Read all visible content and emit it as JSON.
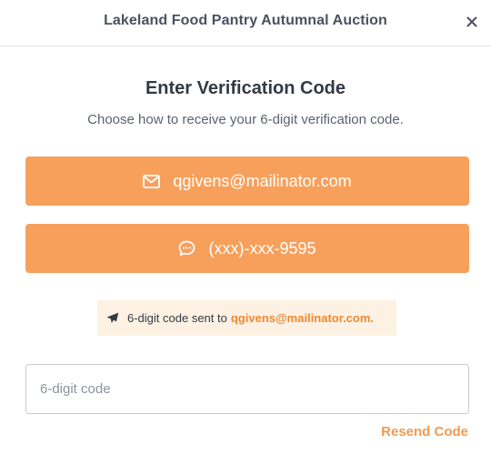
{
  "header": {
    "title": "Lakeland Food Pantry Autumnal Auction",
    "close_icon": "close-icon"
  },
  "main": {
    "heading": "Enter Verification Code",
    "subheading": "Choose how to receive your 6-digit verification code.",
    "options": [
      {
        "icon": "envelope-icon",
        "label": "qgivens@mailinator.com"
      },
      {
        "icon": "chat-bubble-icon",
        "label": "(xxx)-xxx-9595"
      }
    ],
    "notice": {
      "icon": "paper-plane-icon",
      "text": "6-digit code sent to",
      "address": "qgivens@mailinator.com."
    },
    "code_field": {
      "placeholder": "6-digit code",
      "value": ""
    },
    "resend_label": "Resend Code"
  },
  "colors": {
    "accent": "#f7a05c",
    "accent_text": "#ef8a2e",
    "notice_bg": "#fdf1e3"
  }
}
